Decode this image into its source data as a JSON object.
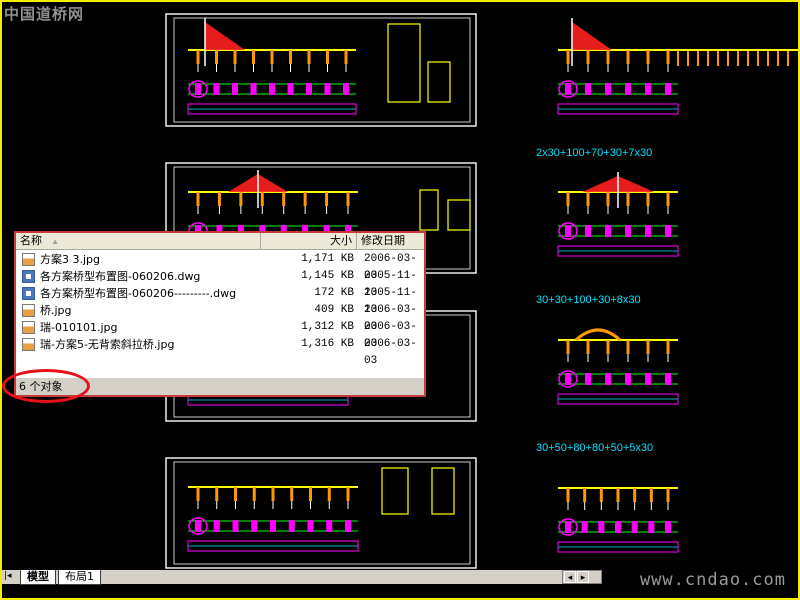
{
  "watermarks": {
    "top_left": "中国道桥网",
    "bottom_right": "www.cndao.com"
  },
  "span_labels": [
    "2x30+100+70+30+7x30",
    "30+30+100+30+8x30",
    "30+50+80+80+50+5x30"
  ],
  "explorer": {
    "columns": {
      "name": "名称",
      "size": "大小",
      "modified": "修改日期"
    },
    "files": [
      {
        "icon": "jpg-file-icon",
        "name": "方案3 3.jpg",
        "size": "1,171 KB",
        "date": "2006-03-03"
      },
      {
        "icon": "dwg-file-icon",
        "name": "各方案桥型布置图-060206.dwg",
        "size": "1,145 KB",
        "date": "2005-11-13"
      },
      {
        "icon": "dwg-file-icon",
        "name": "各方案桥型布置图-060206---------.dwg",
        "size": "172 KB",
        "date": "2005-11-13"
      },
      {
        "icon": "jpg-file-icon",
        "name": "桥.jpg",
        "size": "409 KB",
        "date": "2006-03-03"
      },
      {
        "icon": "jpg-file-icon",
        "name": "瑞-010101.jpg",
        "size": "1,312 KB",
        "date": "2006-03-03"
      },
      {
        "icon": "jpg-file-icon",
        "name": "瑞-方案5-无背索斜拉桥.jpg",
        "size": "1,316 KB",
        "date": "2006-03-03"
      }
    ],
    "status": "6 个对象"
  },
  "layout_tabs": {
    "model": "模型",
    "layout1": "布局1"
  },
  "colors": {
    "frame": "#f2ee00",
    "highlight_ring": "#e8101a",
    "drawing_bg": "#000000"
  }
}
